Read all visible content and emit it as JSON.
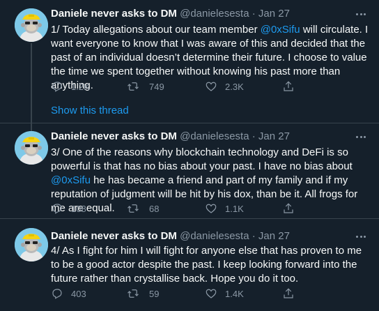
{
  "tweets": [
    {
      "name": "Daniele never asks to DM",
      "handle": "@danielesesta",
      "sep": "·",
      "date": "Jan 27",
      "text_parts": [
        "1/ Today allegations about our team member ",
        "@0xSifu",
        " will circulate. I want everyone to know that I was aware of this and decided that the past of an individual doesn’t determine their future. I choose to value the time we spent together without knowing his past more than anything."
      ],
      "replies": "1.2K",
      "retweets": "749",
      "likes": "2.3K",
      "show_thread": "Show this thread"
    },
    {
      "name": "Daniele never asks to DM",
      "handle": "@danielesesta",
      "sep": "·",
      "date": "Jan 27",
      "text_parts": [
        "3/ One of the reasons why blockchain technology and DeFi is so powerful is that has no bias about your past. I have no bias about ",
        "@0xSifu",
        " he has became a friend and part of my family and if my reputation of judgment will be hit by his dox, than be it. All frogs for me are equal."
      ],
      "replies": "108",
      "retweets": "68",
      "likes": "1.1K"
    },
    {
      "name": "Daniele never asks to DM",
      "handle": "@danielesesta",
      "sep": "·",
      "date": "Jan 27",
      "text_parts": [
        "4/ As I fight for him I will fight for anyone else that has proven to me to be a good actor despite the past. I keep looking forward into the future rather than crystallise back. Hope you do it too."
      ],
      "replies": "403",
      "retweets": "59",
      "likes": "1.4K"
    }
  ],
  "icons": {
    "reply": "reply-icon",
    "retweet": "retweet-icon",
    "like": "heart-icon",
    "share": "share-icon",
    "more": "more-icon"
  },
  "colors": {
    "background": "#15202b",
    "text": "#f7f9f9",
    "secondary": "#8b98a5",
    "link": "#1d9bf0",
    "divider": "#38444d"
  }
}
